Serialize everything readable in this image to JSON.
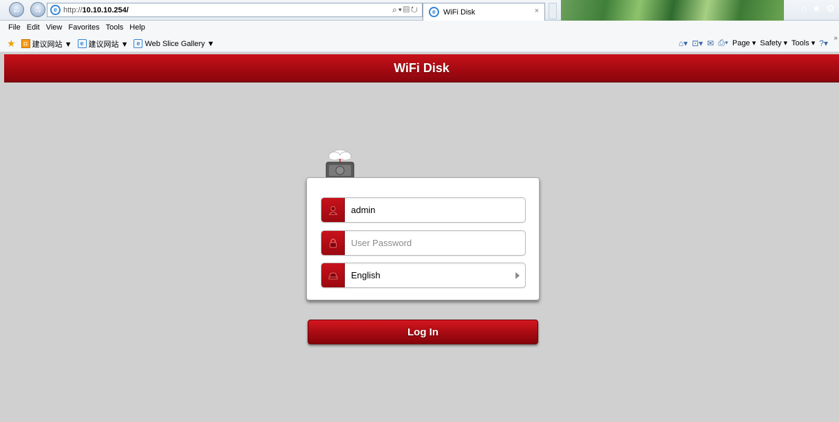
{
  "browser": {
    "url_prefix": "http://",
    "url_host": "10.10.10.254/",
    "tab_title": "WiFi Disk",
    "tab_close": "×",
    "menu": [
      "File",
      "Edit",
      "View",
      "Favorites",
      "Tools",
      "Help"
    ],
    "favorites": [
      {
        "label": "建议网站 ▼",
        "icon": "orange-site-icon"
      },
      {
        "label": "建议网站 ▼",
        "icon": "ie-page-icon"
      },
      {
        "label": "Web Slice Gallery ▼",
        "icon": "ie-page-icon"
      }
    ],
    "commands": [
      "Page ▾",
      "Safety ▾",
      "Tools ▾"
    ]
  },
  "app": {
    "title": "WiFi Disk"
  },
  "login": {
    "username_value": "admin",
    "password_placeholder": "User Password",
    "language_value": "English",
    "login_label": "Log In"
  },
  "colors": {
    "brand_red": "#a50a12",
    "page_bg": "#d0d0d0"
  }
}
